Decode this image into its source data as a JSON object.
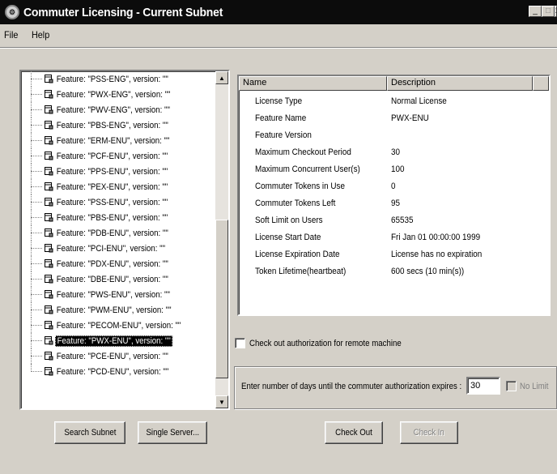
{
  "window": {
    "title": "Commuter Licensing - Current Subnet",
    "app_icon": "license-app-icon"
  },
  "menu": [
    "File",
    "Help"
  ],
  "tree": {
    "items": [
      "Feature: \"PSS-ENG\", version: \"\"",
      "Feature: \"PWX-ENG\", version: \"\"",
      "Feature: \"PWV-ENG\", version: \"\"",
      "Feature: \"PBS-ENG\", version: \"\"",
      "Feature: \"ERM-ENU\", version: \"\"",
      "Feature: \"PCF-ENU\", version: \"\"",
      "Feature: \"PPS-ENU\", version: \"\"",
      "Feature: \"PEX-ENU\", version: \"\"",
      "Feature: \"PSS-ENU\", version: \"\"",
      "Feature: \"PBS-ENU\", version: \"\"",
      "Feature: \"PDB-ENU\", version: \"\"",
      "Feature: \"PCI-ENU\", version: \"\"",
      "Feature: \"PDX-ENU\", version: \"\"",
      "Feature: \"DBE-ENU\", version: \"\"",
      "Feature: \"PWS-ENU\", version: \"\"",
      "Feature: \"PWM-ENU\", version: \"\"",
      "Feature: \"PECOM-ENU\", version: \"\"",
      "Feature: \"PWX-ENU\", version: \"\"",
      "Feature: \"PCE-ENU\", version: \"\"",
      "Feature: \"PCD-ENU\", version: \"\""
    ],
    "selected_index": 17
  },
  "details": {
    "headers": {
      "name": "Name",
      "description": "Description"
    },
    "rows": [
      {
        "name": "License Type",
        "value": "Normal License"
      },
      {
        "name": "Feature Name",
        "value": "PWX-ENU"
      },
      {
        "name": "Feature Version",
        "value": ""
      },
      {
        "name": "Maximum Checkout Period",
        "value": "30"
      },
      {
        "name": "Maximum Concurrent User(s)",
        "value": "100"
      },
      {
        "name": "Commuter Tokens in Use",
        "value": "0"
      },
      {
        "name": "Commuter Tokens Left",
        "value": "95"
      },
      {
        "name": "Soft Limit on Users",
        "value": "65535"
      },
      {
        "name": "License Start Date",
        "value": "Fri Jan 01 00:00:00 1999"
      },
      {
        "name": "License Expiration Date",
        "value": "License has no expiration"
      },
      {
        "name": "Token Lifetime(heartbeat)",
        "value": "600 secs (10 min(s))"
      }
    ]
  },
  "remote_checkbox_label": "Check out authorization for remote machine",
  "expiry": {
    "label": "Enter number of days until the commuter authorization expires :",
    "days_value": "30",
    "no_limit_label": "No Limit"
  },
  "buttons": {
    "search_subnet": "Search Subnet",
    "single_server": "Single Server...",
    "check_out": "Check Out",
    "check_in": "Check In"
  }
}
